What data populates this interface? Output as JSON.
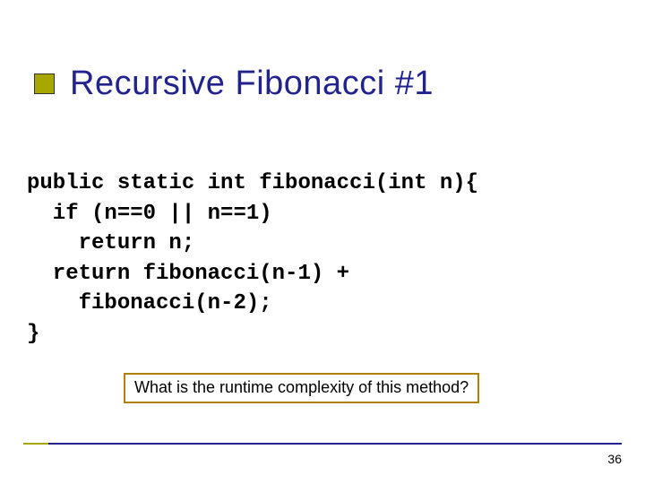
{
  "title": "Recursive Fibonacci #1",
  "code": {
    "line1": "public static int fibonacci(int n){",
    "line2": "  if (n==0 || n==1)",
    "line3": "    return n;",
    "line4": "  return fibonacci(n-1) +",
    "line5": "    fibonacci(n-2);",
    "line6": "}"
  },
  "callout": "What is the runtime complexity of this method?",
  "page_number": "36"
}
